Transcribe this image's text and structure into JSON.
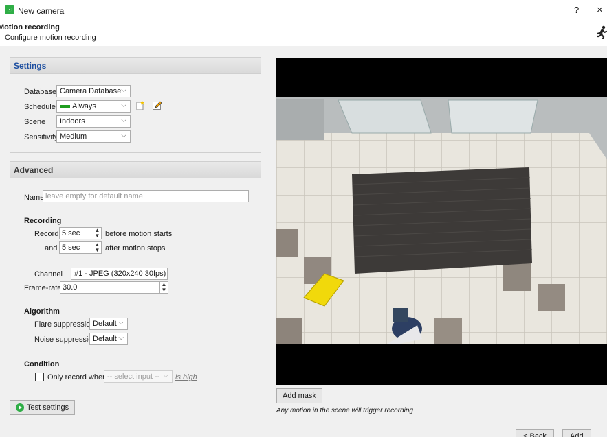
{
  "window": {
    "title": "New camera",
    "help": "?",
    "close": "×"
  },
  "page": {
    "title": "Motion recording",
    "subtitle": "Configure motion recording"
  },
  "settings": {
    "header": "Settings",
    "database_label": "Database",
    "database_value": "Camera Database",
    "schedule_label": "Schedule",
    "schedule_value": "Always",
    "schedule_color": "#1f9d1f",
    "scene_label": "Scene",
    "scene_value": "Indoors",
    "sensitivity_label": "Sensitivity",
    "sensitivity_value": "Medium"
  },
  "advanced": {
    "header": "Advanced",
    "name_label": "Name",
    "name_placeholder": "leave empty for default name",
    "recording_title": "Recording",
    "record_label": "Record",
    "record_before_value": "5 sec",
    "record_before_suffix": "before motion starts",
    "and_label": "and",
    "record_after_value": "5 sec",
    "record_after_suffix": "after motion stops",
    "channel_label": "Channel",
    "channel_value": "#1 - JPEG (320x240 30fps)",
    "framerate_label": "Frame-rate",
    "framerate_value": "30.0",
    "algorithm_title": "Algorithm",
    "flare_label": "Flare suppression",
    "flare_value": "Default",
    "noise_label": "Noise suppression",
    "noise_value": "Default",
    "condition_title": "Condition",
    "only_record_label": "Only record when",
    "select_input_value": "-- select input --",
    "is_high_link": "is high"
  },
  "buttons": {
    "test_settings": "Test settings",
    "add_mask": "Add mask",
    "back": "< Back",
    "add": "Add"
  },
  "hint_text": "Any motion in the scene will trigger recording"
}
